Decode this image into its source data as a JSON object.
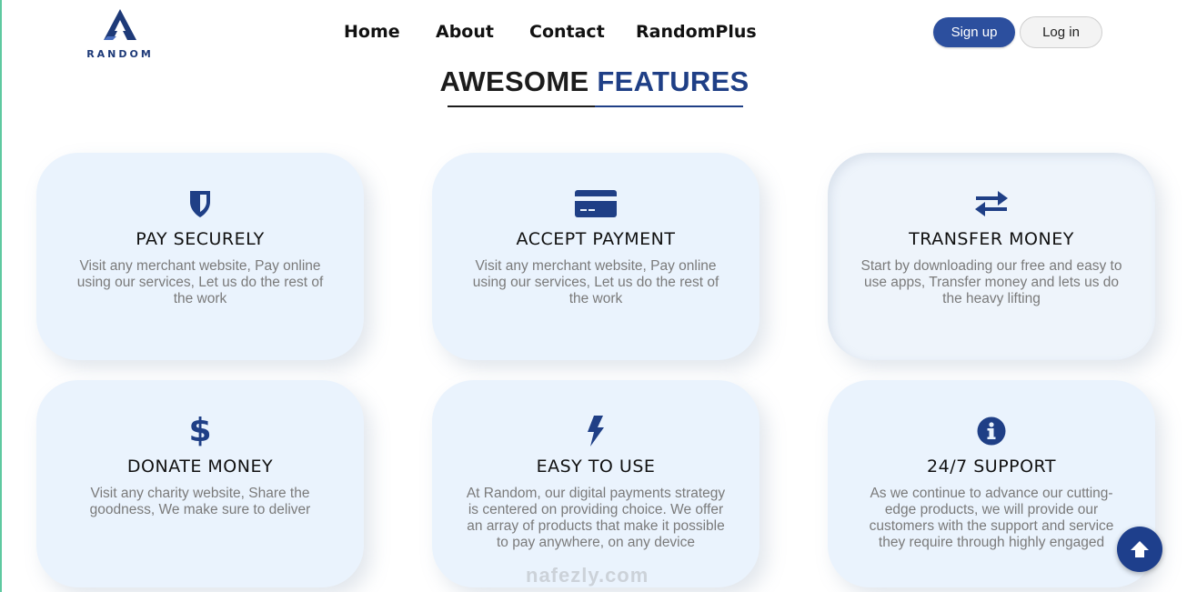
{
  "brand": {
    "logo_text": "RANDOM",
    "accent": "#1f3f86"
  },
  "nav": {
    "items": [
      {
        "label": "Home"
      },
      {
        "label": "About"
      },
      {
        "label": "Contact"
      },
      {
        "label": "RandomPlus"
      }
    ]
  },
  "auth": {
    "signup_label": "Sign up",
    "login_label": "Log in"
  },
  "section": {
    "heading_dark": "AWESOME",
    "heading_blue": "FEATURES"
  },
  "features": [
    {
      "icon": "shield-icon",
      "title": "PAY SECURELY",
      "description": "Visit any merchant website, Pay online using our services, Let us do the rest of the work"
    },
    {
      "icon": "credit-card-icon",
      "title": "ACCEPT PAYMENT",
      "description": "Visit any merchant website, Pay online using our services, Let us do the rest of the work"
    },
    {
      "icon": "exchange-arrows-icon",
      "title": "TRANSFER MONEY",
      "description": "Start by downloading our free and easy to use apps, Transfer money and lets us do the heavy lifting"
    },
    {
      "icon": "dollar-icon",
      "title": "DONATE MONEY",
      "description": "Visit any charity website, Share the goodness, We make sure to deliver"
    },
    {
      "icon": "lightning-bolt-icon",
      "title": "EASY TO USE",
      "description": "At Random, our digital payments strategy is centered on providing choice. We offer an array of products that make it possible to pay anywhere, on any device"
    },
    {
      "icon": "info-circle-icon",
      "title": "24/7 SUPPORT",
      "description": "As we continue to advance our cutting-edge products, we will provide our customers with the support and service they require through highly engaged"
    }
  ],
  "watermark": {
    "text": "nafezly.com"
  }
}
